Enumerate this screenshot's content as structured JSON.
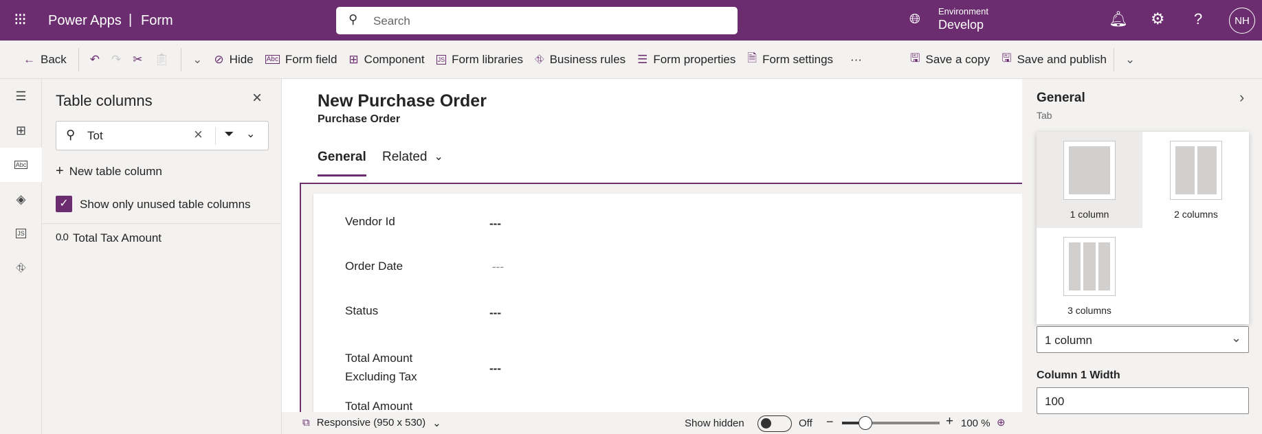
{
  "header": {
    "app": "Power Apps",
    "separator": "|",
    "page": "Form",
    "search_placeholder": "Search",
    "env_label": "Environment",
    "env_value": "Develop",
    "avatar": "NH"
  },
  "toolbar": {
    "back": "Back",
    "hide": "Hide",
    "form_field": "Form field",
    "component": "Component",
    "form_libraries": "Form libraries",
    "business_rules": "Business rules",
    "form_properties": "Form properties",
    "form_settings": "Form settings",
    "more": "···",
    "save_copy": "Save a copy",
    "save_publish": "Save and publish"
  },
  "table_columns": {
    "title": "Table columns",
    "search_value": "Tot",
    "new_column": "New table column",
    "show_unused": "Show only unused table columns",
    "items": [
      {
        "type": "0.0",
        "label": "Total Tax Amount"
      }
    ]
  },
  "form": {
    "title": "New Purchase Order",
    "subtitle": "Purchase Order",
    "tabs": [
      "General",
      "Related"
    ],
    "fields": [
      {
        "label": "Vendor Id",
        "value": "---"
      },
      {
        "label": "Order Date",
        "value": "---"
      },
      {
        "label": "Status",
        "value": "---"
      },
      {
        "label": "Total Amount Excluding Tax",
        "value": "---"
      },
      {
        "label": "Total Amount",
        "value": ""
      }
    ]
  },
  "bottom": {
    "responsive": "Responsive (950 x 530)",
    "show_hidden": "Show hidden",
    "toggle_state": "Off",
    "zoom": "100 %",
    "zoom_value": 100
  },
  "right_panel": {
    "title": "General",
    "subtitle": "Tab",
    "layouts": [
      "1 column",
      "2 columns",
      "3 columns"
    ],
    "selected_layout": "1 column",
    "col_width_label": "Column 1 Width",
    "col_width_value": "100"
  }
}
